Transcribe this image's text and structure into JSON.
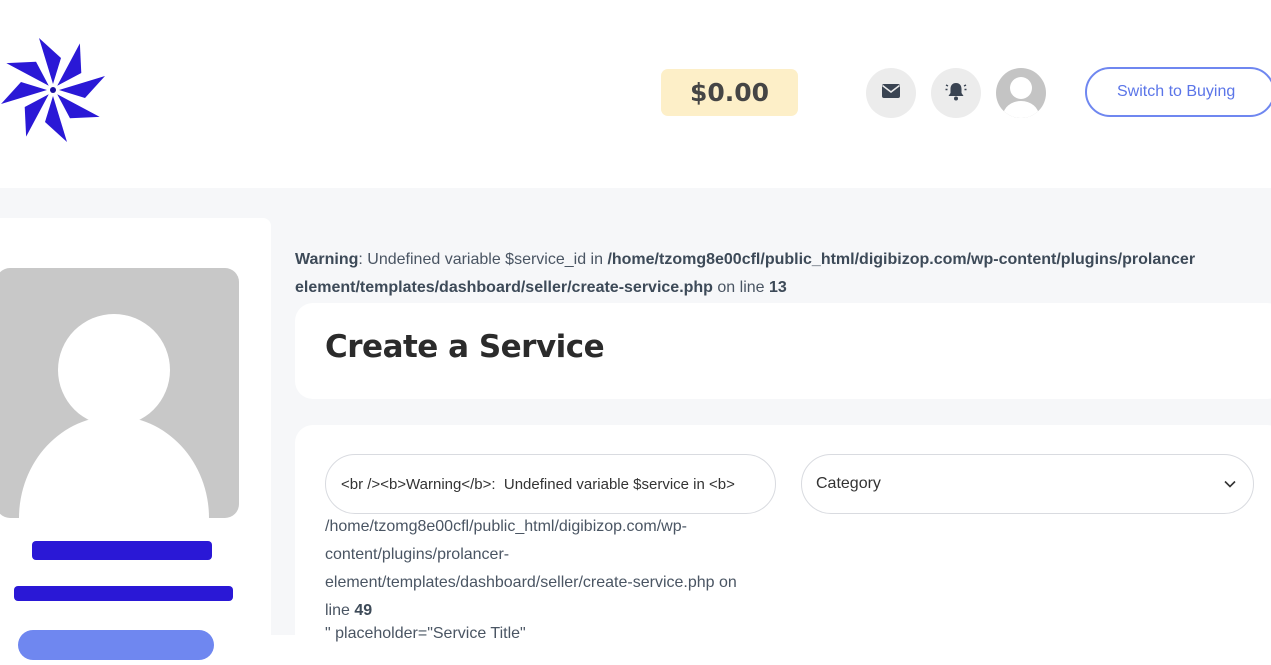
{
  "header": {
    "logo_icon": "pinwheel-logo-icon",
    "balance": "$0.00",
    "messages_icon": "envelope-icon",
    "notifications_icon": "bell-icon",
    "avatar_icon": "user-avatar-icon",
    "switch_label": "Switch to Buying"
  },
  "warning": {
    "label": "Warning",
    "message": ": Undefined variable $service_id in ",
    "path": "/home/tzomg8e00cfl/public_html/digibizop.com/wp-content/plugins/prolancer-element/templates/dashboard/seller/create-service.php",
    "path_line1": "/home/tzomg8e00cfl/public_html/digibizop.com/wp-content/plugins/prolancer",
    "path_line2": "element/templates/dashboard/seller/create-service.php",
    "on_line": " on line ",
    "line_number": "13"
  },
  "page": {
    "title": "Create a Service"
  },
  "form": {
    "title_input_value": "<br /><b>Warning</b>:  Undefined variable $service in <b>",
    "category_select": "Category",
    "error_lines": [
      "/home/tzomg8e00cfl/public_html/digibizop.com/wp-",
      "content/plugins/prolancer-",
      "element/templates/dashboard/seller/create-service.php on"
    ],
    "error_line_prefix": "line ",
    "error_line_number": "49",
    "cut_off_text": "\" placeholder=\"Service Title\""
  },
  "colors": {
    "brand": "#2a18d6",
    "accent": "#5b75e8",
    "balance_bg": "#fdefc8",
    "page_bg": "#f6f7f9"
  }
}
